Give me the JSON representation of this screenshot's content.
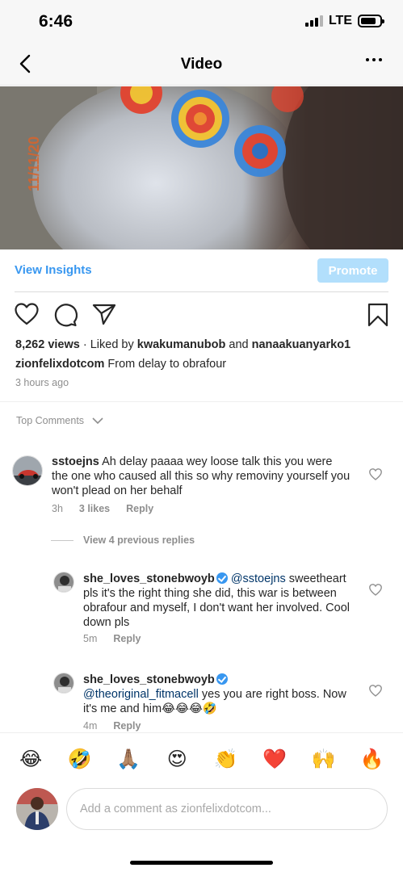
{
  "status_bar": {
    "time": "6:46",
    "network": "LTE"
  },
  "nav": {
    "title": "Video",
    "back_icon": "chevron-left-icon",
    "more_icon": "ellipsis-icon"
  },
  "insights": {
    "view_insights": "View Insights",
    "promote": "Promote",
    "promote_color": "#b2dffc",
    "link_color": "#3897f0"
  },
  "video": {
    "overlay_stamp": "11/11/20"
  },
  "post": {
    "views": "8,262 views",
    "liked_by_prefix": "Liked by",
    "liked_user_1": "kwakumanubob",
    "liked_and": "and",
    "liked_user_2": "nanaakuanyarko1",
    "caption_user": "zionfelixdotcom",
    "caption_text": "From delay to obrafour",
    "time_ago": "3 hours ago"
  },
  "top_comments": {
    "label": "Top Comments"
  },
  "comments": [
    {
      "username": "sstoejns",
      "text": "Ah delay paaaa wey loose talk this you were the one who caused all this so why removiny yourself you won't plead on her behalf",
      "time": "3h",
      "likes": "3 likes",
      "reply": "Reply"
    }
  ],
  "view_previous": "View 4 previous replies",
  "replies": [
    {
      "username": "she_loves_stonebwoyb",
      "mention": "@sstoejns",
      "text": "sweetheart pls it's the right thing she did, this war is between obrafour and myself, I don't want her involved. Cool down pls",
      "time": "5m",
      "reply": "Reply"
    },
    {
      "username": "she_loves_stonebwoyb",
      "mention": "@theoriginal_fitmacell",
      "text": "yes you are right boss. Now it's me and him😂😂😂🤣",
      "time": "4m",
      "reply": "Reply"
    }
  ],
  "emoji_bar": [
    "😂",
    "🤣",
    "🙏🏽",
    "😍",
    "👏",
    "❤️",
    "🙌",
    "🔥"
  ],
  "composer": {
    "placeholder": "Add a comment as zionfelixdotcom..."
  }
}
